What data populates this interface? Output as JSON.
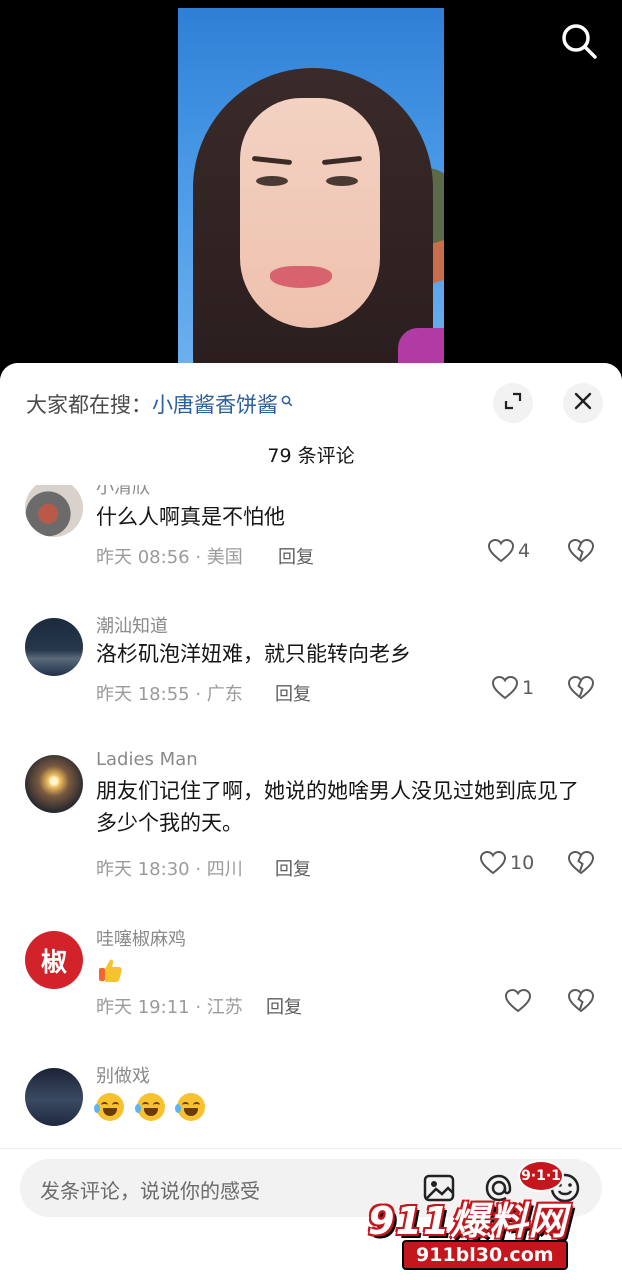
{
  "header": {
    "search_icon": "search-icon"
  },
  "sheet": {
    "hot_search_label": "大家都在搜：",
    "hot_search_term": "小唐酱香饼酱",
    "comment_count_title": "79 条评论",
    "expand_icon": "expand-icon",
    "close_icon": "close-icon"
  },
  "comments": [
    {
      "user": "小清欣",
      "text": "什么人啊真是不怕他",
      "meta": "昨天 08:56 · 美国",
      "reply": "回复",
      "likes": "4"
    },
    {
      "user": "潮汕知道",
      "text": "洛杉矶泡洋妞难，就只能转向老乡",
      "meta": "昨天 18:55 · 广东",
      "reply": "回复",
      "likes": "1"
    },
    {
      "user": "Ladies Man",
      "text": "朋友们记住了啊，她说的她啥男人没见过她到底见了多少个我的天。",
      "meta": "昨天 18:30 · 四川",
      "reply": "回复",
      "likes": "10"
    },
    {
      "user": "哇噻椒麻鸡",
      "text": "",
      "emoji": [
        "thumbs-up"
      ],
      "meta": "昨天 19:11 · 江苏",
      "reply": "回复",
      "likes": ""
    },
    {
      "user": "别做戏",
      "text": "",
      "emoji": [
        "tears-of-joy",
        "tears-of-joy",
        "tears-of-joy"
      ],
      "meta": "",
      "reply": "",
      "likes": ""
    }
  ],
  "avatar_text": {
    "c4": "椒"
  },
  "input": {
    "placeholder": "发条评论，说说你的感受"
  },
  "watermark": {
    "main": "911爆料网",
    "badge": "9·1·1",
    "url": "911bl30.com"
  },
  "colors": {
    "accent_link": "#2b5f9e",
    "watermark_red": "#c4161c"
  }
}
